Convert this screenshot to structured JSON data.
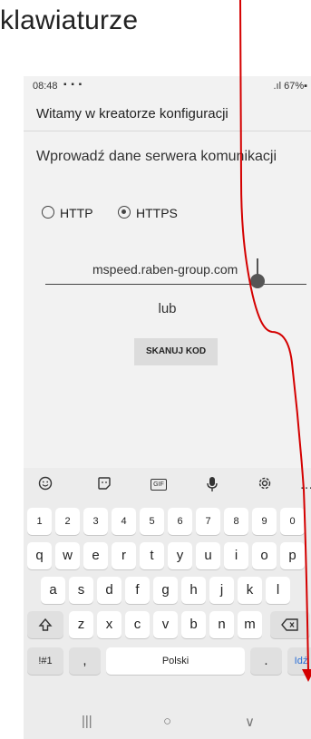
{
  "caption": "klawiaturze",
  "status": {
    "time": "08:48",
    "notif_icons": "▪ ▪ ▪",
    "battery": ".ıl 67%▪"
  },
  "appbar": {
    "title": "Witamy w kreatorze konfiguracji"
  },
  "form": {
    "heading": "Wprowadź dane serwera komunikacji",
    "protocol_options": [
      {
        "label": "HTTP",
        "selected": false
      },
      {
        "label": "HTTPS",
        "selected": true
      }
    ],
    "server_value": "mspeed.raben-group.com",
    "or_label": "lub",
    "scan_button": "SKANUJ KOD"
  },
  "keyboard": {
    "toolbar": [
      "smiley-icon",
      "sticker-icon",
      "gif-icon",
      "microphone-icon",
      "settings-icon",
      "more-icon"
    ],
    "gif_label": "GIF",
    "more_label": "…",
    "numbers": [
      "1",
      "2",
      "3",
      "4",
      "5",
      "6",
      "7",
      "8",
      "9",
      "0"
    ],
    "row1": [
      "q",
      "w",
      "e",
      "r",
      "t",
      "y",
      "u",
      "i",
      "o",
      "p"
    ],
    "row2": [
      "a",
      "s",
      "d",
      "f",
      "g",
      "h",
      "j",
      "k",
      "l"
    ],
    "row3": [
      "z",
      "x",
      "c",
      "v",
      "b",
      "n",
      "m"
    ],
    "symbols_key": "!#1",
    "comma_key": ",",
    "space_label": "Polski",
    "period_key": ".",
    "go_key": "Idź"
  },
  "navbar": {
    "recent": "|||",
    "home": "○",
    "back": "∨"
  },
  "colors": {
    "annotation_line": "#d40000",
    "accent": "#2a6fd6"
  }
}
